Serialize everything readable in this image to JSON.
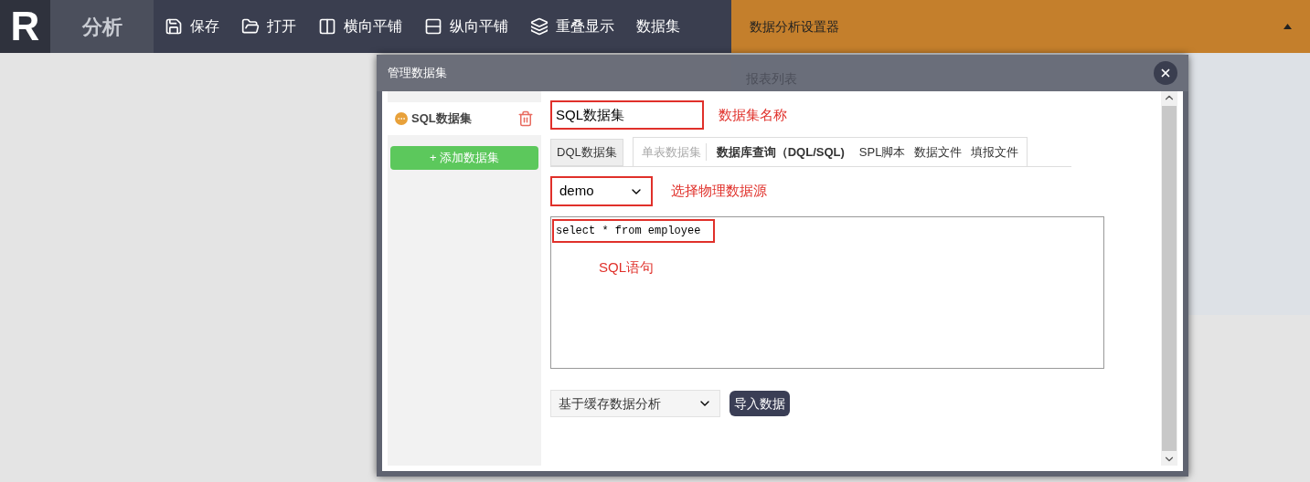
{
  "toolbar": {
    "logo": "R",
    "title": "分析",
    "items": [
      {
        "label": "保存"
      },
      {
        "label": "打开"
      },
      {
        "label": "横向平铺"
      },
      {
        "label": "纵向平铺"
      },
      {
        "label": "重叠显示"
      },
      {
        "label": "数据集"
      }
    ]
  },
  "settings_panel": {
    "title": "数据分析设置器",
    "expanded": true,
    "tab": "报表列表"
  },
  "dialog": {
    "title": "管理数据集",
    "sidebar": {
      "items": [
        {
          "label": "SQL数据集",
          "selected": true
        }
      ],
      "add_button": "+ 添加数据集"
    },
    "name_field": {
      "value": "SQL数据集",
      "annotation": "数据集名称"
    },
    "mode_button": "DQL数据集",
    "tabs": [
      {
        "label": "单表数据集",
        "selected": false,
        "disabled": true
      },
      {
        "label": "数据库查询（DQL/SQL)",
        "selected": true,
        "disabled": false
      },
      {
        "label": "SPL脚本",
        "selected": false,
        "disabled": false
      },
      {
        "label": "数据文件",
        "selected": false,
        "disabled": false
      },
      {
        "label": "填报文件",
        "selected": false,
        "disabled": false
      }
    ],
    "datasource": {
      "value": "demo",
      "annotation": "选择物理数据源"
    },
    "sql": {
      "value": "select * from employee",
      "annotation": "SQL语句"
    },
    "analysis_mode": {
      "value": "基于缓存数据分析"
    },
    "import_button": "导入数据"
  }
}
